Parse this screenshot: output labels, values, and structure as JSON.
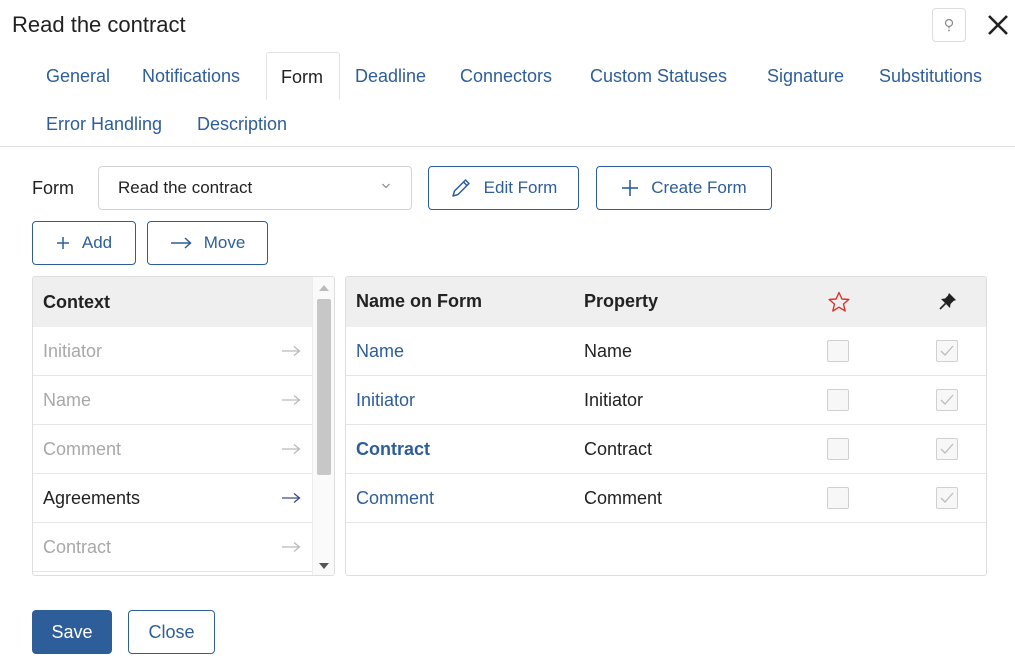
{
  "dialog": {
    "title": "Read the contract"
  },
  "tabs": [
    {
      "label": "General"
    },
    {
      "label": "Notifications"
    },
    {
      "label": "Form"
    },
    {
      "label": "Deadline"
    },
    {
      "label": "Connectors"
    },
    {
      "label": "Custom Statuses"
    },
    {
      "label": "Signature"
    },
    {
      "label": "Substitutions"
    },
    {
      "label": "Error Handling"
    },
    {
      "label": "Description"
    }
  ],
  "active_tab": "Form",
  "form": {
    "label": "Form",
    "selected": "Read the contract",
    "edit_label": "Edit Form",
    "create_label": "Create Form",
    "add_label": "Add",
    "move_label": "Move"
  },
  "context": {
    "header": "Context",
    "items": [
      {
        "label": "Initiator"
      },
      {
        "label": "Name"
      },
      {
        "label": "Comment"
      },
      {
        "label": "Agreements"
      },
      {
        "label": "Contract"
      }
    ]
  },
  "table": {
    "headers": {
      "name": "Name on Form",
      "property": "Property"
    },
    "rows": [
      {
        "name": "Name",
        "property": "Name",
        "required": false,
        "readonly": true
      },
      {
        "name": "Initiator",
        "property": "Initiator",
        "required": false,
        "readonly": true
      },
      {
        "name": "Contract",
        "property": "Contract",
        "required": false,
        "readonly": true
      },
      {
        "name": "Comment",
        "property": "Comment",
        "required": false,
        "readonly": true
      }
    ]
  },
  "footer": {
    "save_label": "Save",
    "close_label": "Close"
  },
  "colors": {
    "accent": "#2e5e9a",
    "required_star": "#d9342b"
  },
  "icons": {
    "help": "help-icon",
    "close": "close-icon",
    "edit": "pencil-icon",
    "create": "plus-icon",
    "add": "plus-icon",
    "move": "arrow-right-icon",
    "required": "star-icon",
    "readonly": "pin-icon"
  }
}
